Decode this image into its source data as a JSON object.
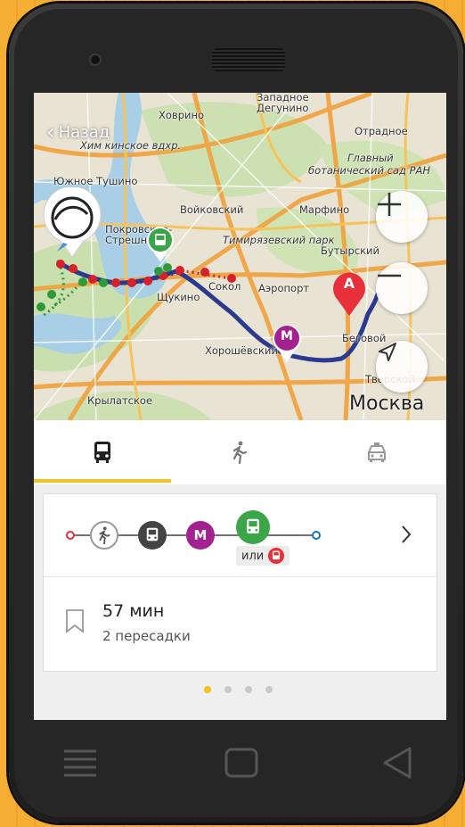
{
  "map": {
    "back_label": "Назад",
    "city_label": "Москва",
    "labels": [
      {
        "t": "Ховрино",
        "i": false
      },
      {
        "t": "Западное",
        "i": false
      },
      {
        "t": "Дегунино",
        "i": false
      },
      {
        "t": "Отрадное",
        "i": false
      },
      {
        "t": "Хим кинское вдхр.",
        "i": true
      },
      {
        "t": "Южное Тушино",
        "i": false
      },
      {
        "t": "Главный",
        "i": true
      },
      {
        "t": "ботанический сад РАН",
        "i": true
      },
      {
        "t": "Войковский",
        "i": false
      },
      {
        "t": "Марфино",
        "i": false
      },
      {
        "t": "Покровское-",
        "i": false
      },
      {
        "t": "Стрешнево",
        "i": false
      },
      {
        "t": "Тимирязевский парк",
        "i": true
      },
      {
        "t": "Бутырский",
        "i": false
      },
      {
        "t": "Щукино",
        "i": false
      },
      {
        "t": "Сокол",
        "i": false
      },
      {
        "t": "Аэропорт",
        "i": false
      },
      {
        "t": "Хорошёвский",
        "i": false
      },
      {
        "t": "Беговой",
        "i": false
      },
      {
        "t": "Крылатское",
        "i": false
      },
      {
        "t": "Тверской",
        "i": false
      }
    ],
    "marker_a": "A",
    "marker_metro": "M",
    "colors": {
      "route": "#2b3a8f",
      "metro_red": "#d6202a",
      "metro_green": "#2e9a3a",
      "bus": "#3aa647",
      "metro": "#a3228d",
      "marker_a": "#e8303a"
    }
  },
  "tabs": [
    {
      "name": "tab-transit",
      "icon": "bus-icon",
      "active": true
    },
    {
      "name": "tab-walk",
      "icon": "pedestrian-icon",
      "active": false
    },
    {
      "name": "tab-taxi",
      "icon": "taxi-icon",
      "active": false
    }
  ],
  "route": {
    "segments": [
      "walk",
      "bus",
      "metro",
      "bus"
    ],
    "alt_label": "или",
    "duration": "57 мин",
    "transfers": "2 пересадки"
  },
  "pager": {
    "count": 4,
    "active": 0
  }
}
